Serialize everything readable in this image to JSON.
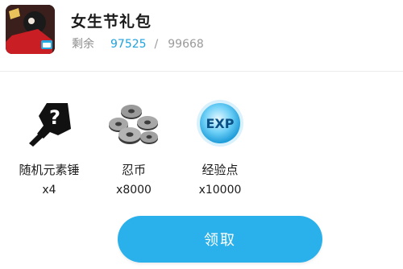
{
  "header": {
    "title": "女生节礼包",
    "remain_label": "剩余",
    "remain_count": "97525",
    "separator": "/",
    "remain_total": "99668",
    "app_icon": "game-app-icon"
  },
  "rewards": [
    {
      "name": "随机元素锤",
      "quantity": "x4",
      "icon": "hammer-question-icon"
    },
    {
      "name": "忍币",
      "quantity": "x8000",
      "icon": "ninja-coins-icon"
    },
    {
      "name": "经验点",
      "quantity": "x10000",
      "icon": "exp-orb-icon"
    }
  ],
  "claim_button": {
    "label": "领取"
  },
  "colors": {
    "accent": "#2ab0ea",
    "count": "#1fa3dd"
  }
}
